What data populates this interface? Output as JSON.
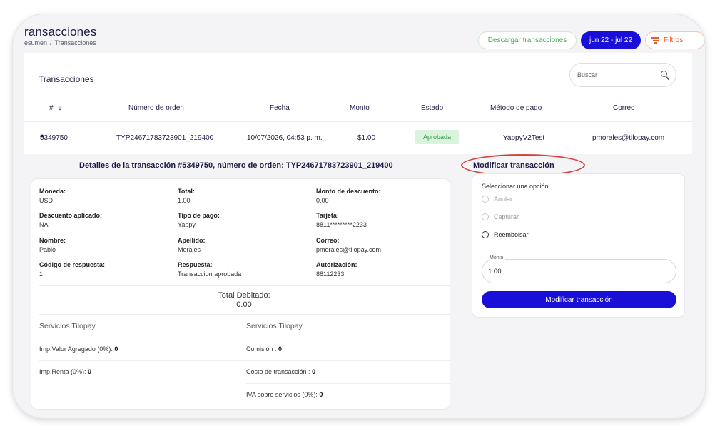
{
  "header": {
    "title": "ransacciones",
    "breadcrumb": {
      "parent": "esumen",
      "separator": "/",
      "current": "Transacciones"
    },
    "download_label": "Descargar transacciones",
    "date_range_label": "jun 22 - jul 22",
    "filters_label": "Filtros"
  },
  "card": {
    "title": "Transacciones",
    "search_placeholder": "Buscar"
  },
  "table": {
    "columns": [
      "#",
      "Número de orden",
      "Fecha",
      "Monto",
      "Estado",
      "Método de pago",
      "Correo"
    ],
    "sort_indicator": "↓",
    "rows": [
      {
        "id": "5349750",
        "order": "TYP24671783723901_219400",
        "date": "10/07/2026, 04:53 p. m.",
        "amount": "$1.00",
        "status": "Aprobada",
        "method": "YappyV2Test",
        "email": "pmorales@tilopay.com"
      }
    ]
  },
  "details": {
    "heading": "Detalles de la transacción #5349750, número de orden: TYP24671783723901_219400",
    "fields": [
      {
        "label": "Moneda:",
        "value": "USD"
      },
      {
        "label": "Total:",
        "value": "1.00"
      },
      {
        "label": "Monto de descuento:",
        "value": "0.00"
      },
      {
        "label": "Descuento aplicado:",
        "value": "NA"
      },
      {
        "label": "Tipo de pago:",
        "value": "Yappy"
      },
      {
        "label": "Tarjeta:",
        "value": "8811*********2233"
      },
      {
        "label": "Nombre:",
        "value": "Pablo"
      },
      {
        "label": "Apellido:",
        "value": "Morales"
      },
      {
        "label": "Correo:",
        "value": "pmorales@tilopay.com"
      },
      {
        "label": "Código de respuesta:",
        "value": "1"
      },
      {
        "label": "Respuesta:",
        "value": "Transaccion aprobada"
      },
      {
        "label": "Autorización:",
        "value": "88112233"
      }
    ],
    "total_label": "Total Debitado:",
    "total_value": "0.00",
    "services": {
      "left_title": "Servicios Tilopay",
      "right_title": "Servicios Tilopay",
      "left_items": [
        {
          "label": "Imp.Valor Agregado (0%): ",
          "value": "0"
        },
        {
          "label": "Imp.Renta (0%): ",
          "value": "0"
        }
      ],
      "right_items": [
        {
          "label": "Comisión : ",
          "value": "0"
        },
        {
          "label": "Costo de transacción : ",
          "value": "0"
        },
        {
          "label": "IVA sobre servicios (0%): ",
          "value": "0"
        }
      ]
    }
  },
  "modify": {
    "heading": "Modificar transacción",
    "select_label": "Seleccionar una opción",
    "options": [
      {
        "label": "Anular",
        "enabled": false
      },
      {
        "label": "Capturar",
        "enabled": false
      },
      {
        "label": "Reembolsar",
        "enabled": true
      }
    ],
    "amount_label": "Monto",
    "amount_value": "1.00",
    "submit_label": "Modificar transacción"
  },
  "colors": {
    "primary": "#1a0fd8",
    "navy_text": "#1c1c44",
    "success": "#42b05a",
    "filter_accent": "#f05a28",
    "highlight_oval": "#d7403d"
  }
}
